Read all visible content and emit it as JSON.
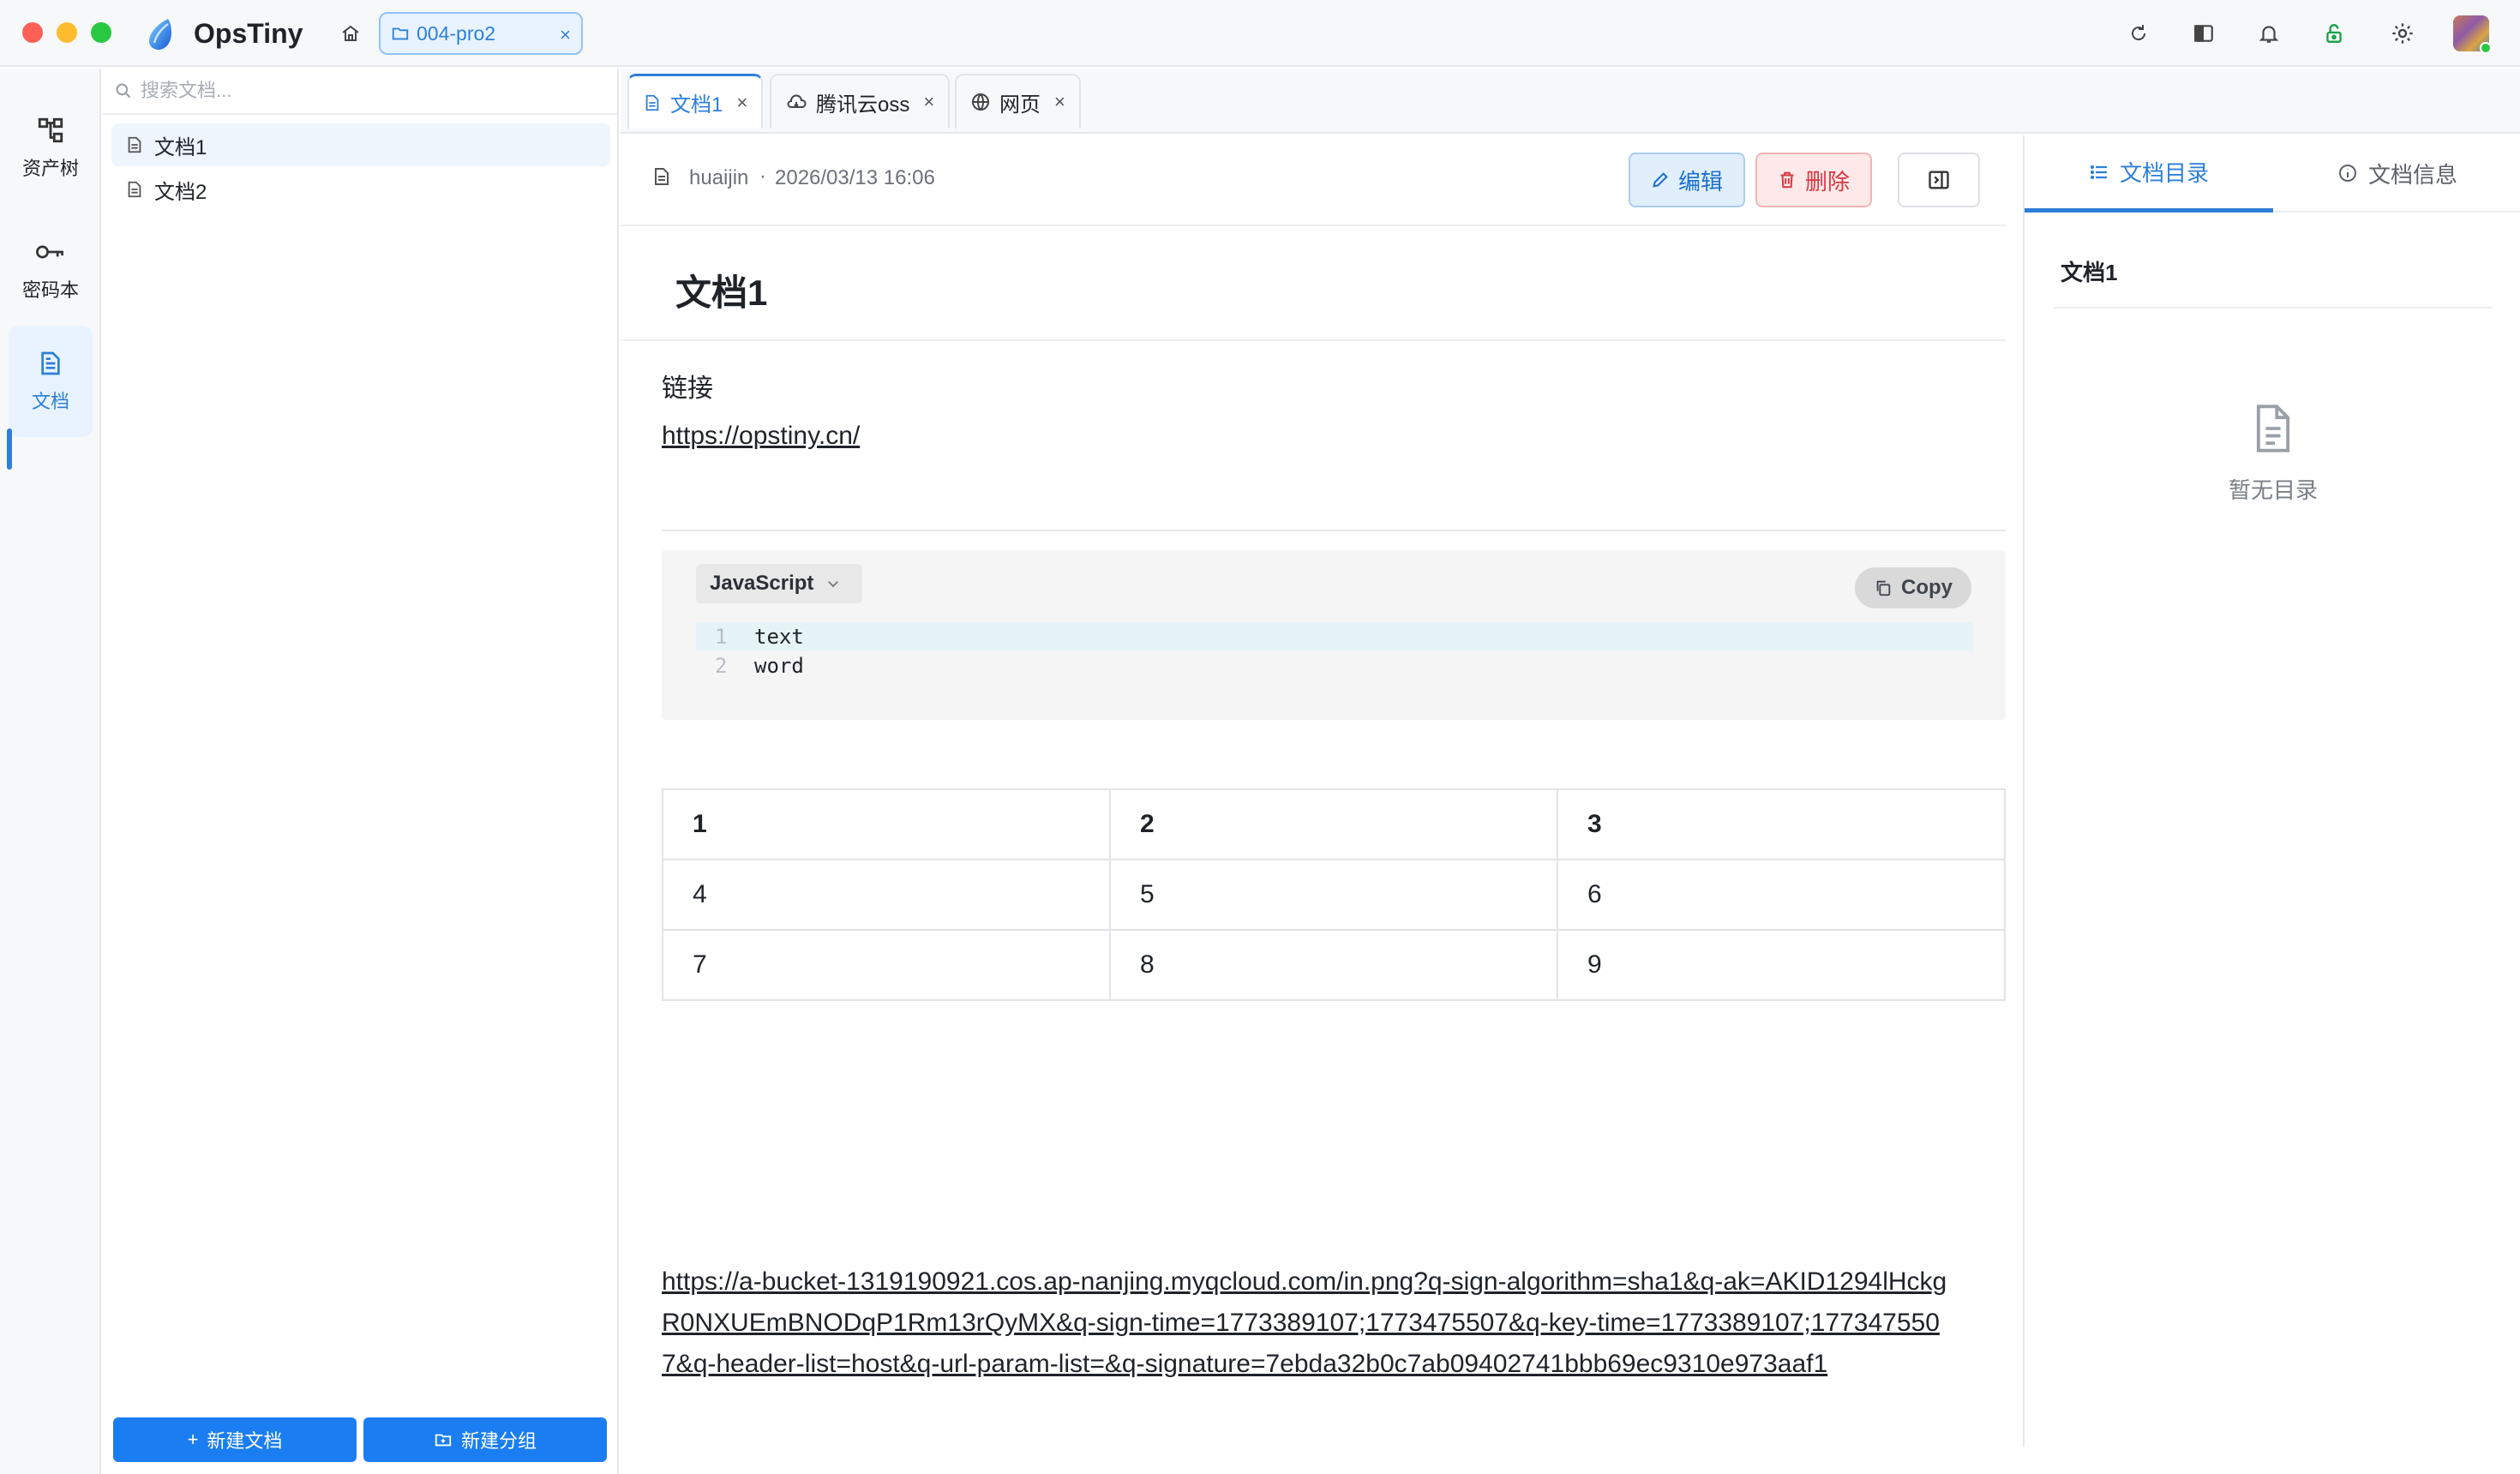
{
  "app": {
    "name": "OpsTiny",
    "workspace_tab": "004-pro2",
    "workspace_close": "×"
  },
  "leftnav": {
    "items": [
      {
        "label": "资产树",
        "icon": "asset-tree-icon"
      },
      {
        "label": "密码本",
        "icon": "key-icon"
      },
      {
        "label": "文档",
        "icon": "document-icon"
      }
    ],
    "active": "文档"
  },
  "doclist": {
    "search_placeholder": "搜索文档...",
    "items": [
      "文档1",
      "文档2"
    ],
    "new_doc_label": "新建文档",
    "new_group_label": "新建分组"
  },
  "tabs": [
    {
      "label": "文档1",
      "icon": "document-icon",
      "close": "×"
    },
    {
      "label": "腾讯云oss",
      "icon": "cloud-icon",
      "close": "×"
    },
    {
      "label": "网页",
      "icon": "globe-icon",
      "close": "×"
    }
  ],
  "doc": {
    "author": "huaijin",
    "separator": "·",
    "time": "2026/03/13 16:06",
    "edit_label": "编辑",
    "delete_label": "删除",
    "title": "文档1",
    "paragraph": "链接",
    "link": "https://opstiny.cn/",
    "code": {
      "language": "JavaScript",
      "copy_label": "Copy",
      "lines": [
        {
          "n": "1",
          "text": "text"
        },
        {
          "n": "2",
          "text": "word"
        }
      ]
    },
    "table": {
      "rows": [
        [
          "1",
          "2",
          "3"
        ],
        [
          "4",
          "5",
          "6"
        ],
        [
          "7",
          "8",
          "9"
        ]
      ]
    },
    "long_link": "https://a-bucket-1319190921.cos.ap-nanjing.myqcloud.com/in.png?q-sign-algorithm=sha1&q-ak=AKID1294lHckgR0NXUEmBNODqP1Rm13rQyMX&q-sign-time=1773389107;1773475507&q-key-time=1773389107;1773475507&q-header-list=host&q-url-param-list=&q-signature=7ebda32b0c7ab09402741bbb69ec9310e973aaf1"
  },
  "rightpanel": {
    "tab_toc": "文档目录",
    "tab_info": "文档信息",
    "toc_item": "文档1",
    "empty_text": "暂无目录"
  },
  "colors": {
    "accent": "#2d7fd8",
    "primary_button": "#1a7ef2",
    "danger": "#d9363e"
  }
}
